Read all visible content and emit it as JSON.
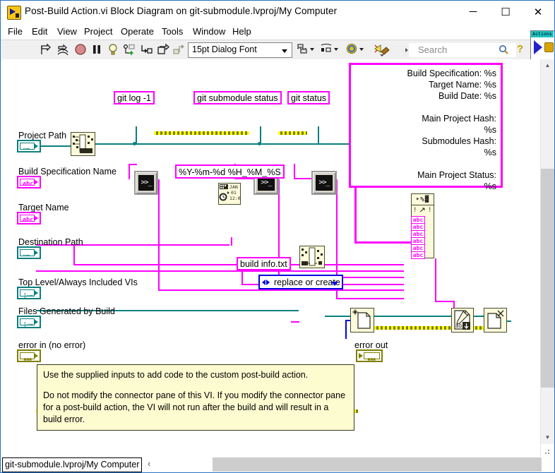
{
  "window": {
    "title": "Post-Build Action.vi Block Diagram on git-submodule.lvproj/My Computer",
    "minimize": "─",
    "maximize": "☐",
    "close": "✕"
  },
  "menu": {
    "items": [
      "File",
      "Edit",
      "View",
      "Project",
      "Operate",
      "Tools",
      "Window",
      "Help"
    ]
  },
  "toolbar": {
    "icons": [
      "run-arrow-icon",
      "run-continuously-icon",
      "abort-execution-icon",
      "pause-icon",
      "highlight-execution-icon",
      "retain-wire-values-icon",
      "step-into-icon",
      "step-over-icon",
      "step-out-icon"
    ],
    "font_selector": "15pt Dialog Font",
    "align_objects": "align-objects-icon",
    "distribute_objects": "distribute-objects-icon",
    "reorder": "reorder-icon",
    "clean_up_diagram": "clean-up-diagram-icon",
    "search_placeholder": "Search",
    "search_value": "",
    "help_icon": "context-help-icon",
    "actions_palette": "Actions"
  },
  "statusbar": {
    "context": "git-submodule.lvproj/My Computer",
    "back_glyph": "‹"
  },
  "diagram": {
    "terminals": [
      {
        "label": "Project Path",
        "type": "path",
        "glyph": "▭→"
      },
      {
        "label": "Build Specification Name",
        "type": "string",
        "glyph": "abc"
      },
      {
        "label": "Target Name",
        "type": "string",
        "glyph": "abc"
      },
      {
        "label": "Destination Path",
        "type": "path",
        "glyph": "▭→"
      },
      {
        "label": "Top Level/Always Included VIs",
        "type": "path-array",
        "glyph": "[▭"
      },
      {
        "label": "Files Generated by Build",
        "type": "path-array",
        "glyph": "[▭"
      },
      {
        "label": "error in (no error)",
        "type": "error",
        "glyph": "▓▓"
      },
      {
        "label": "error out",
        "type": "error",
        "glyph": "▓▓"
      }
    ],
    "string_constants": [
      {
        "name": "git-log-constant",
        "text": "git log -1"
      },
      {
        "name": "git-submodule-status-constant",
        "text": "git submodule status"
      },
      {
        "name": "git-status-constant",
        "text": "git status"
      },
      {
        "name": "date-format-constant",
        "text": "%Y-%m-%d %H_%M_%S"
      },
      {
        "name": "build-info-filename-constant",
        "text": "build info.txt"
      }
    ],
    "report_template": "Build Specification: %s\nTarget Name: %s\nBuild Date: %s\n\nMain Project Hash:\n%s\nSubmodules Hash:\n%s\n\nMain Project Status:\n%s",
    "enum_ring": {
      "name": "file-operation-ring",
      "value": "replace or create"
    },
    "nodes": [
      {
        "name": "strip-path-node",
        "icon": "strip-path-icon"
      },
      {
        "name": "system-exec-git-log",
        "icon": "system-exec-icon",
        "glyph": ">>_"
      },
      {
        "name": "system-exec-git-submodule",
        "icon": "system-exec-icon",
        "glyph": ">>_"
      },
      {
        "name": "system-exec-git-status",
        "icon": "system-exec-icon",
        "glyph": ">>_"
      },
      {
        "name": "format-date-time-string-node",
        "icon": "calendar-clock-icon"
      },
      {
        "name": "format-into-string-node",
        "icon": "percent-format-icon",
        "glyph": "‣%▓",
        "inputs": 6
      },
      {
        "name": "build-path-node",
        "icon": "build-path-icon"
      },
      {
        "name": "open-create-replace-file-node",
        "icon": "open-file-icon"
      },
      {
        "name": "write-to-text-file-node",
        "icon": "write-file-icon"
      },
      {
        "name": "close-file-node",
        "icon": "close-file-icon"
      }
    ],
    "comment": {
      "line1": "Use the supplied inputs to add code to the custom post-build action.",
      "line2": "Do not modify the connector pane of this VI.  If you modify the connector pane for a post-build action, the VI will not run after the build and will result in a build error."
    },
    "colors": {
      "string_wire": "#ff00ff",
      "path_wire": "#0a7f7f",
      "error_wire": "#7f7f00",
      "enum_wire": "#0000e0",
      "node_fill": "#fdfbdc",
      "comment_fill": "#fdfbd0"
    }
  }
}
